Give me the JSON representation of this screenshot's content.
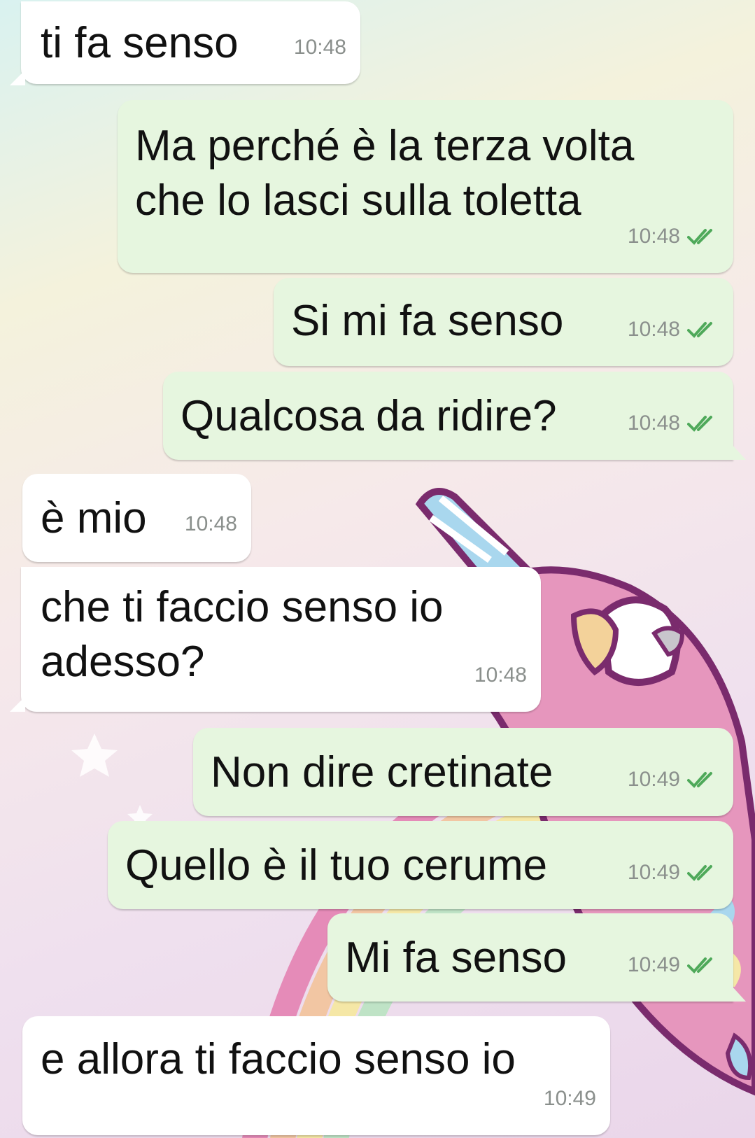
{
  "theme": {
    "incoming_bg": "#ffffff",
    "outgoing_bg": "#e6f6df",
    "tick_color": "#4fa95a",
    "time_color": "#8a8f8c"
  },
  "messages": [
    {
      "direction": "in",
      "text": "ti fa senso",
      "time": "10:48"
    },
    {
      "direction": "out",
      "lines": [
        "Ma perché è la terza volta",
        "che lo lasci sulla toletta"
      ],
      "time": "10:48",
      "status": "read-double-tick-icon"
    },
    {
      "direction": "out",
      "text": "Si mi fa senso",
      "time": "10:48",
      "status": "read-double-tick-icon"
    },
    {
      "direction": "out",
      "text": "Qualcosa da ridire?",
      "time": "10:48",
      "status": "read-double-tick-icon"
    },
    {
      "direction": "in",
      "text": "è mio",
      "time": "10:48"
    },
    {
      "direction": "in",
      "lines": [
        "che ti faccio senso io",
        "adesso?"
      ],
      "time": "10:48"
    },
    {
      "direction": "out",
      "text": "Non dire cretinate",
      "time": "10:49",
      "status": "read-double-tick-icon"
    },
    {
      "direction": "out",
      "text": "Quello è il tuo cerume",
      "time": "10:49",
      "status": "read-double-tick-icon"
    },
    {
      "direction": "out",
      "text": "Mi fa senso",
      "time": "10:49",
      "status": "read-double-tick-icon"
    },
    {
      "direction": "in",
      "text": "e allora ti faccio senso io",
      "time": "10:49"
    }
  ]
}
